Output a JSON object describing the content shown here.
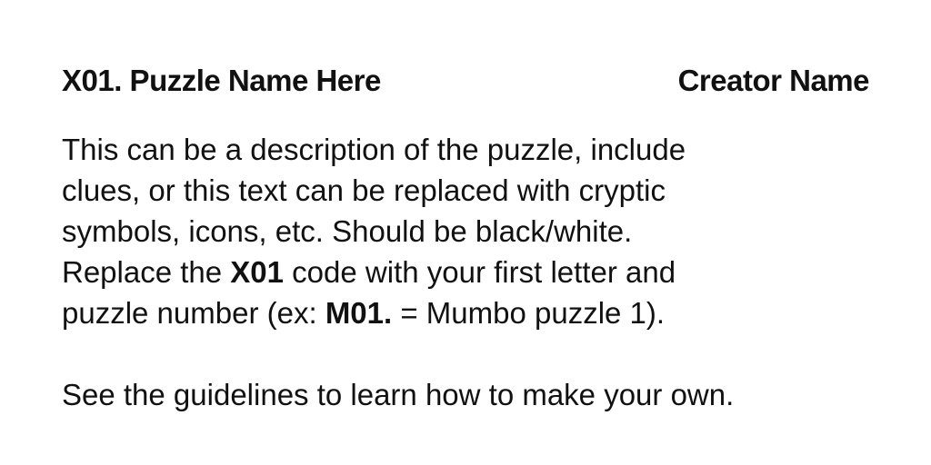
{
  "header": {
    "title": "X01. Puzzle Name Here",
    "creator": "Creator Name"
  },
  "body": {
    "line1": "This can be a description of the puzzle, include",
    "line2": "clues, or this text can be replaced with cryptic",
    "line3": "symbols, icons, etc. Should be black/white.",
    "line4_pre": "Replace the ",
    "line4_bold": "X01",
    "line4_post": " code with your first letter and",
    "line5_pre": "puzzle number (ex: ",
    "line5_bold": "M01.",
    "line5_post": " = Mumbo puzzle 1).",
    "footer": "See the guidelines to learn how to make your own."
  }
}
